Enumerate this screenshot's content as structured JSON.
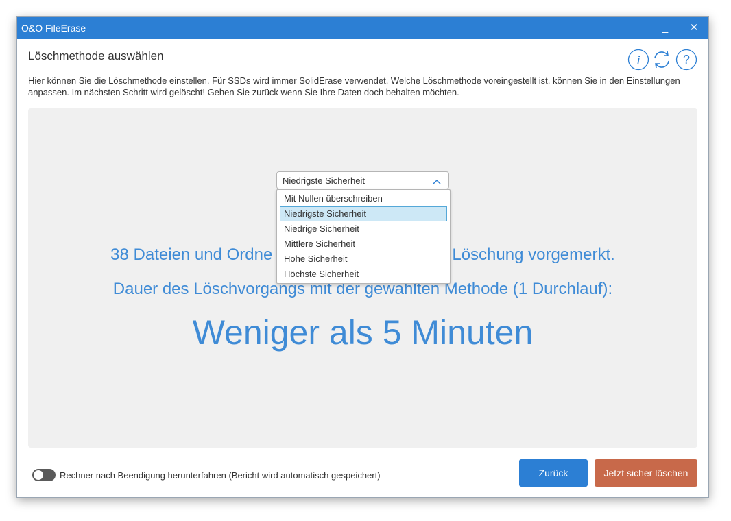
{
  "window": {
    "title": "O&O FileErase",
    "minimize_label": "_",
    "close_label": "✕"
  },
  "header": {
    "title": "Löschmethode auswählen",
    "icons": [
      "info-icon",
      "refresh-icon",
      "help-icon"
    ]
  },
  "description": "Hier können Sie die Löschmethode einstellen. Für SSDs wird immer SolidErase verwendet. Welche Löschmethode voreingestellt ist, können Sie in den Einstellungen anpassen. Im nächsten Schritt wird gelöscht! Gehen Sie zurück wenn Sie Ihre Daten doch behalten möchten.",
  "method_select": {
    "value": "Niedrigste Sicherheit",
    "options": [
      "Mit Nullen überschreiben",
      "Niedrigste Sicherheit",
      "Niedrige Sicherheit",
      "Mittlere Sicherheit",
      "Hohe Sicherheit",
      "Höchste Sicherheit"
    ],
    "selected_index": 1
  },
  "summary": {
    "files_line_left": "38 Dateien und Ordne",
    "files_line_right": "Löschung vorgemerkt.",
    "duration_line": "Dauer des Löschvorgangs mit der gewählten Methode (1 Durchlauf):",
    "duration_value": "Weniger als 5 Minuten"
  },
  "footer": {
    "shutdown_toggle_on": false,
    "shutdown_label": "Rechner nach Beendigung herunterfahren (Bericht wird automatisch gespeichert)",
    "back_button": "Zurück",
    "erase_button": "Jetzt sicher löschen"
  },
  "colors": {
    "titlebar": "#2c7fd4",
    "accent_text": "#3f8bd6",
    "erase_button": "#c8694a",
    "panel_bg": "#f0f0f0"
  }
}
